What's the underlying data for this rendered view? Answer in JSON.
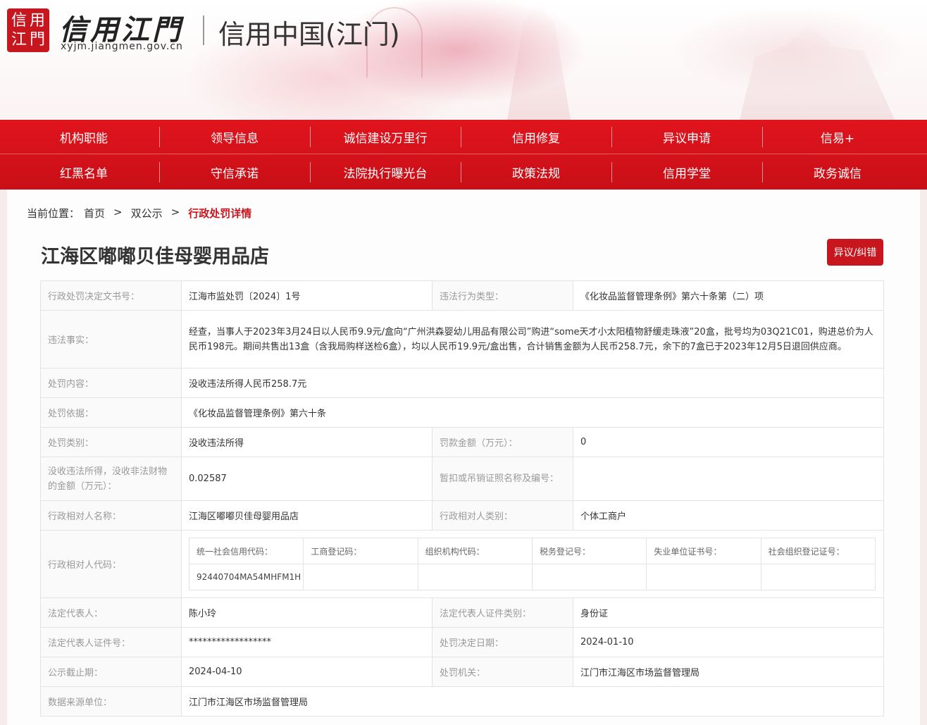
{
  "header": {
    "logo_seal": [
      "信",
      "用",
      "江",
      "門"
    ],
    "logo_script": "信用江門",
    "logo_domain": "xyjm.jiangmen.gov.cn",
    "site_title": "信用中国(江门)"
  },
  "nav": {
    "row1": [
      "机构职能",
      "领导信息",
      "诚信建设万里行",
      "信用修复",
      "异议申请",
      "信易+"
    ],
    "row2": [
      "红黑名单",
      "守信承诺",
      "法院执行曝光台",
      "政策法规",
      "信用学堂",
      "政务诚信"
    ]
  },
  "breadcrumb": {
    "prefix": "当前位置：",
    "home": "首页",
    "sep": ">",
    "section": "双公示",
    "current": "行政处罚详情"
  },
  "page": {
    "title": "江海区嘟嘟贝佳母婴用品店",
    "objection_label": "异议/纠错"
  },
  "detail": {
    "decision_no_label": "行政处罚决定文书号：",
    "decision_no": "江海市监处罚〔2024〕1号",
    "violation_type_label": "违法行为类型：",
    "violation_type": "《化妆品监督管理条例》第六十条第（二）项",
    "facts_label": "违法事实：",
    "facts": "经查，当事人于2023年3月24日以人民币9.9元/盒向“广州洪森婴幼儿用品有限公司”购进“some天才小太阳植物舒缓走珠液”20盒，批号均为03Q21C01，购进总价为人民币198元。期间共售出13盒（含我局购样送检6盒），均以人民币19.9元/盒出售，合计销售金额为人民币258.7元，余下的7盒已于2023年12月5日退回供应商。",
    "content_label": "处罚内容：",
    "content": "没收违法所得人民币258.7元",
    "basis_label": "处罚依据：",
    "basis": "《化妆品监督管理条例》第六十条",
    "category_label": "处罚类别：",
    "category": "没收违法所得",
    "fine_label": "罚款金额（万元）：",
    "fine": "0",
    "confiscation_label": "没收违法所得，没收非法财物的金额（万元）：",
    "confiscation": "0.02587",
    "license_label": "暂扣或吊销证照名称及编号：",
    "license": "",
    "party_name_label": "行政相对人名称：",
    "party_name": "江海区嘟嘟贝佳母婴用品店",
    "party_type_label": "行政相对人类别：",
    "party_type": "个体工商户",
    "party_code_label": "行政相对人代码：",
    "codes": {
      "headers": [
        "统一社会信用代码：",
        "工商登记码：",
        "组织机构代码：",
        "税务登记号：",
        "失业单位证书号：",
        "社会组织登记证号："
      ],
      "values": [
        "92440704MA54MHFM1H",
        "",
        "",
        "",
        "",
        ""
      ]
    },
    "legal_rep_label": "法定代表人：",
    "legal_rep": "陈小玲",
    "legal_rep_id_type_label": "法定代表人证件类别：",
    "legal_rep_id_type": "身份证",
    "legal_rep_id_label": "法定代表人证件号：",
    "legal_rep_id": "******************",
    "decision_date_label": "处罚决定日期：",
    "decision_date": "2024-01-10",
    "publish_end_label": "公示截止期：",
    "publish_end": "2024-04-10",
    "authority_label": "处罚机关：",
    "authority": "江门市江海区市场监督管理局",
    "source_label": "数据来源单位：",
    "source": "江门市江海区市场监督管理局"
  }
}
